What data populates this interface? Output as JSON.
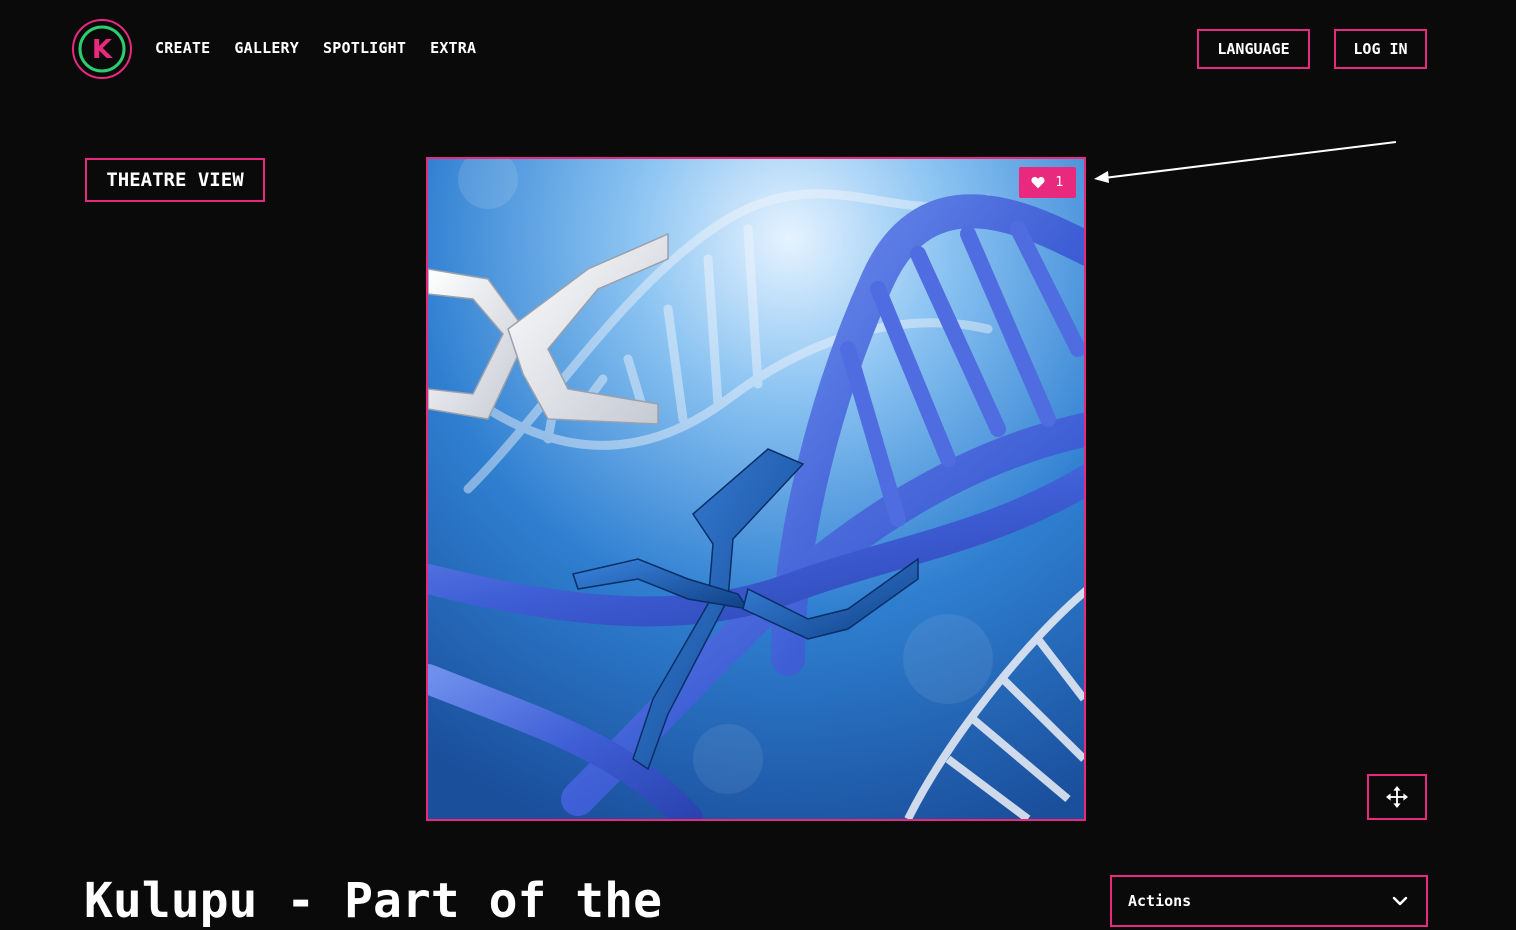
{
  "header": {
    "logo_letter": "K",
    "nav": [
      {
        "label": "CREATE"
      },
      {
        "label": "GALLERY"
      },
      {
        "label": "SPOTLIGHT"
      },
      {
        "label": "EXTRA"
      }
    ],
    "language_label": "LANGUAGE",
    "login_label": "LOG IN"
  },
  "theatre_view_label": "THEATRE VIEW",
  "artwork": {
    "like_count": "1",
    "like_icon": "heart-icon"
  },
  "move_icon": "move-arrows-icon",
  "title": "Kulupu - Part of the",
  "actions": {
    "label": "Actions",
    "icon": "chevron-down-icon"
  },
  "colors": {
    "accent": "#e8297e",
    "background": "#0a0a0a",
    "logo_ring": "#2ecc71"
  }
}
